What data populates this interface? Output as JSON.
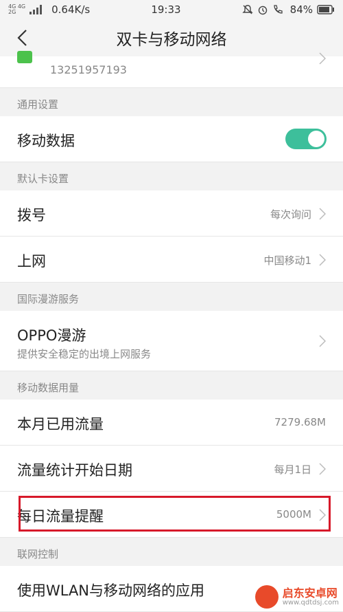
{
  "status": {
    "signal_top": "4G 4G",
    "signal_bottom": "2G",
    "speed": "0.64K/s",
    "time": "19:33",
    "battery": "84%"
  },
  "header": {
    "title": "双卡与移动网络"
  },
  "sim": {
    "number": "13251957193"
  },
  "general": {
    "header": "通用设置",
    "mobile_data": {
      "label": "移动数据",
      "on": true
    }
  },
  "default_card": {
    "header": "默认卡设置",
    "dial": {
      "label": "拨号",
      "value": "每次询问"
    },
    "internet": {
      "label": "上网",
      "value": "中国移动1"
    }
  },
  "roaming": {
    "header": "国际漫游服务",
    "oppo": {
      "label": "OPPO漫游",
      "sublabel": "提供安全稳定的出境上网服务"
    }
  },
  "usage": {
    "header": "移动数据用量",
    "month": {
      "label": "本月已用流量",
      "value": "7279.68M"
    },
    "start_date": {
      "label": "流量统计开始日期",
      "value": "每月1日"
    },
    "daily": {
      "label": "每日流量提醒",
      "value": "5000M"
    }
  },
  "network_control": {
    "header": "联网控制",
    "apps": {
      "label": "使用WLAN与移动网络的应用"
    }
  },
  "watermark": {
    "name": "启东安卓网",
    "url": "www.qdtdsj.com"
  },
  "colors": {
    "toggle_on": "#3dbf9b",
    "highlight": "#d7192a",
    "sim_green": "#4cc24c"
  }
}
